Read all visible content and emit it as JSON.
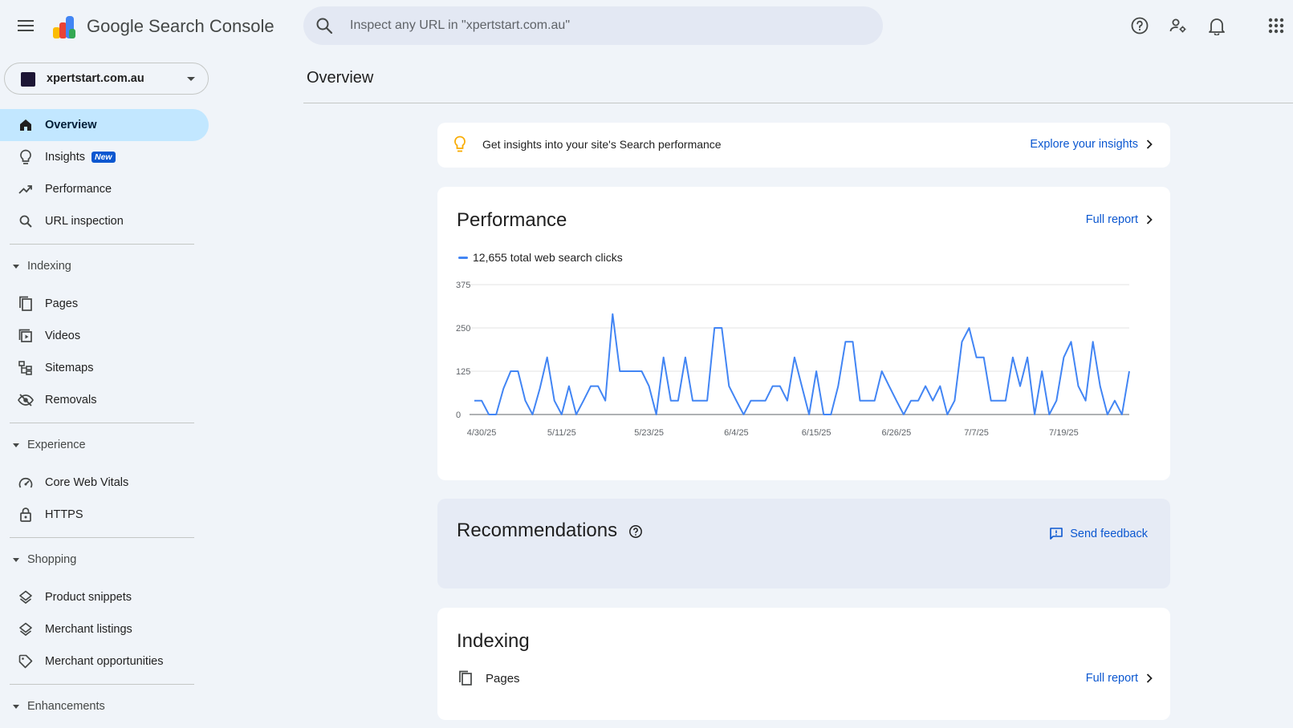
{
  "header": {
    "brand": "Google Search Console",
    "search_placeholder": "Inspect any URL in \"xpertstart.com.au\""
  },
  "property": {
    "name": "xpertstart.com.au"
  },
  "sidebar": {
    "top_items": [
      {
        "label": "Overview",
        "icon": "home-icon",
        "active": true
      },
      {
        "label": "Insights",
        "icon": "lightbulb-icon",
        "badge": "New"
      },
      {
        "label": "Performance",
        "icon": "trending-up-icon"
      },
      {
        "label": "URL inspection",
        "icon": "search-icon"
      }
    ],
    "sections": [
      {
        "title": "Indexing",
        "items": [
          {
            "label": "Pages",
            "icon": "pages-icon"
          },
          {
            "label": "Videos",
            "icon": "video-icon"
          },
          {
            "label": "Sitemaps",
            "icon": "sitemap-icon"
          },
          {
            "label": "Removals",
            "icon": "removals-icon"
          }
        ]
      },
      {
        "title": "Experience",
        "items": [
          {
            "label": "Core Web Vitals",
            "icon": "gauge-icon"
          },
          {
            "label": "HTTPS",
            "icon": "lock-icon"
          }
        ]
      },
      {
        "title": "Shopping",
        "items": [
          {
            "label": "Product snippets",
            "icon": "layers-icon"
          },
          {
            "label": "Merchant listings",
            "icon": "layers-icon"
          },
          {
            "label": "Merchant opportunities",
            "icon": "tag-icon"
          }
        ]
      },
      {
        "title": "Enhancements",
        "items": []
      }
    ]
  },
  "main": {
    "title": "Overview",
    "insights": {
      "text": "Get insights into your site's Search performance",
      "link": "Explore your insights"
    },
    "performance": {
      "title": "Performance",
      "link": "Full report",
      "legend": "12,655 total web search clicks"
    },
    "recommendations": {
      "title": "Recommendations",
      "feedback": "Send feedback"
    },
    "indexing": {
      "title": "Indexing",
      "pages_label": "Pages",
      "link": "Full report"
    }
  },
  "colors": {
    "accent": "#0b57d0",
    "line": "#4285f4",
    "active_nav": "#c2e7ff",
    "background": "#f0f4f9"
  },
  "chart_data": {
    "type": "line",
    "series": [
      {
        "name": "",
        "values": [
          40,
          40,
          0,
          0,
          75,
          125,
          125,
          40,
          0,
          75,
          165,
          40,
          0,
          82,
          0,
          40,
          82,
          82,
          40,
          290,
          125,
          125,
          125,
          125,
          82,
          0,
          165,
          40,
          40,
          165,
          40,
          40,
          40,
          250,
          250,
          82,
          40,
          0,
          40,
          40,
          40,
          82,
          82,
          40,
          165,
          82,
          0,
          125,
          0,
          0,
          82,
          210,
          210,
          40,
          40,
          40,
          125,
          82,
          40,
          0,
          40,
          40,
          82,
          40,
          82,
          0,
          40,
          210,
          250,
          165,
          165,
          40,
          40,
          40,
          165,
          82,
          165,
          0,
          125,
          0,
          40,
          165,
          210,
          82,
          40,
          210,
          82,
          0,
          40,
          0,
          125
        ]
      }
    ],
    "x_ticks": [
      "4/30/25",
      "5/11/25",
      "5/23/25",
      "6/4/25",
      "6/15/25",
      "6/26/25",
      "7/7/25",
      "7/19/25"
    ],
    "x_tick_index": [
      1,
      12,
      24,
      36,
      47,
      58,
      69,
      81
    ],
    "y_ticks": [
      "375",
      "250",
      "125",
      "0"
    ],
    "ylim": [
      0,
      375
    ],
    "grid": true
  }
}
